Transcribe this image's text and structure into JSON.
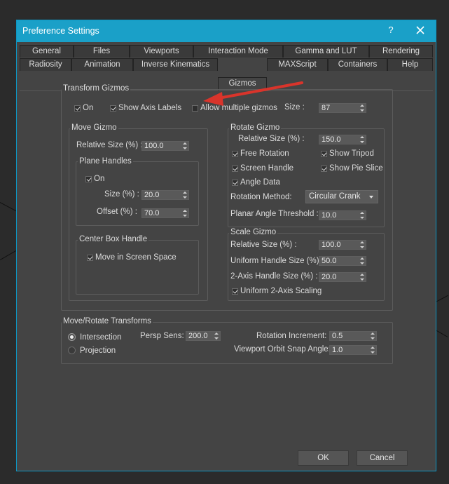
{
  "window": {
    "title": "Preference Settings",
    "help_label": "?"
  },
  "tabs_row1": [
    "General",
    "Files",
    "Viewports",
    "Interaction Mode",
    "Gamma and LUT",
    "Rendering"
  ],
  "tabs_row2": [
    "Radiosity",
    "Animation",
    "Inverse Kinematics",
    "Gizmos",
    "MAXScript",
    "Containers",
    "Help"
  ],
  "active_tab": "Gizmos",
  "transform_gizmos": {
    "title": "Transform Gizmos",
    "on_label": "On",
    "on_checked": true,
    "show_axis_labels_label": "Show Axis Labels",
    "show_axis_labels_checked": true,
    "allow_multiple_label": "Allow multiple gizmos",
    "allow_multiple_checked": false,
    "size_label": "Size :",
    "size_value": "87"
  },
  "move_gizmo": {
    "title": "Move Gizmo",
    "relative_size_label": "Relative Size (%) :",
    "relative_size_value": "100.0",
    "plane_handles_title": "Plane Handles",
    "plane_on_label": "On",
    "plane_on_checked": true,
    "plane_size_label": "Size (%) :",
    "plane_size_value": "20.0",
    "plane_offset_label": "Offset (%) :",
    "plane_offset_value": "70.0",
    "center_box_title": "Center Box Handle",
    "move_screen_space_label": "Move in Screen Space",
    "move_screen_space_checked": true
  },
  "rotate_gizmo": {
    "title": "Rotate Gizmo",
    "relative_size_label": "Relative Size (%) :",
    "relative_size_value": "150.0",
    "free_rotation_label": "Free Rotation",
    "free_rotation_checked": true,
    "show_tripod_label": "Show Tripod",
    "show_tripod_checked": true,
    "screen_handle_label": "Screen Handle",
    "screen_handle_checked": true,
    "show_pie_slice_label": "Show Pie Slice",
    "show_pie_slice_checked": true,
    "angle_data_label": "Angle Data",
    "angle_data_checked": true,
    "rotation_method_label": "Rotation Method:",
    "rotation_method_value": "Circular Crank",
    "planar_threshold_label": "Planar Angle Threshold :",
    "planar_threshold_value": "10.0"
  },
  "scale_gizmo": {
    "title": "Scale Gizmo",
    "relative_size_label": "Relative Size (%) :",
    "relative_size_value": "100.0",
    "uniform_handle_label": "Uniform Handle Size (%) :",
    "uniform_handle_value": "50.0",
    "two_axis_label": "2-Axis Handle Size (%) :",
    "two_axis_value": "20.0",
    "uniform_2axis_label": "Uniform 2-Axis Scaling",
    "uniform_2axis_checked": true
  },
  "move_rotate": {
    "title": "Move/Rotate Transforms",
    "intersection_label": "Intersection",
    "intersection_selected": true,
    "projection_label": "Projection",
    "projection_selected": false,
    "persp_sens_label": "Persp Sens:",
    "persp_sens_value": "200.0",
    "rotation_increment_label": "Rotation Increment:",
    "rotation_increment_value": "0.5",
    "orbit_snap_label": "Viewport Orbit Snap Angle:",
    "orbit_snap_value": "1.0"
  },
  "buttons": {
    "ok": "OK",
    "cancel": "Cancel"
  },
  "colors": {
    "accent": "#1aa0c8",
    "annotation_arrow": "#d9342b",
    "dialog_bg": "#444444"
  }
}
